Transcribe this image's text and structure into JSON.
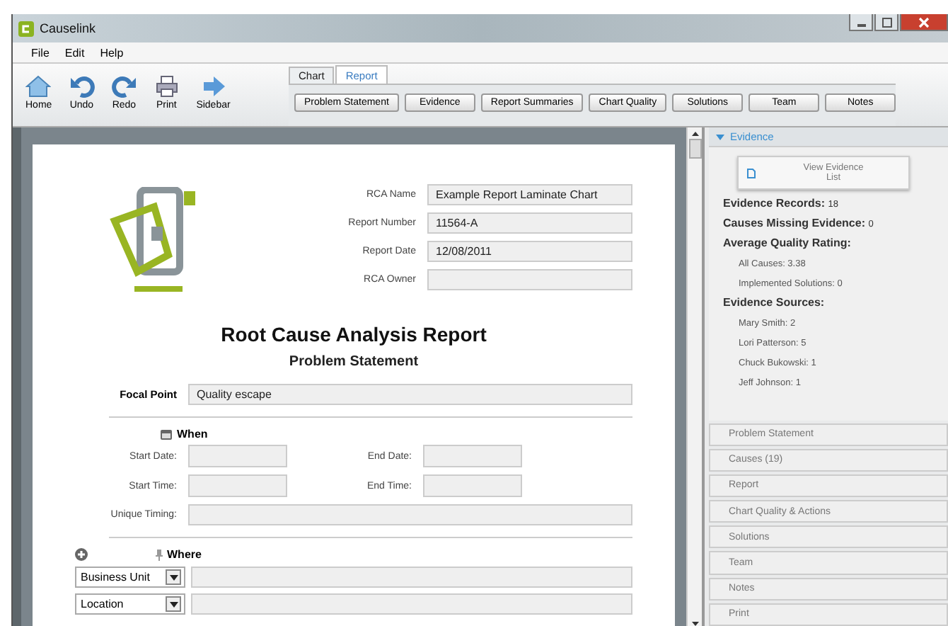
{
  "window": {
    "title": "Causelink"
  },
  "menu": [
    "File",
    "Edit",
    "Help"
  ],
  "toolbar": [
    {
      "label": "Home",
      "kind": "home"
    },
    {
      "label": "Undo",
      "kind": "undo"
    },
    {
      "label": "Redo",
      "kind": "redo"
    },
    {
      "label": "Print",
      "kind": "print"
    },
    {
      "label": "Sidebar",
      "kind": "sidebar"
    }
  ],
  "tabs": [
    {
      "label": "Chart",
      "selected": false
    },
    {
      "label": "Report",
      "selected": true
    }
  ],
  "report_buttons": [
    "Problem Statement",
    "Evidence",
    "Report Summaries",
    "Chart Quality",
    "Solutions",
    "Team",
    "Notes"
  ],
  "report": {
    "header_fields": [
      {
        "label": "RCA Name",
        "value": "Example Report Laminate Chart"
      },
      {
        "label": "Report Number",
        "value": "11564-A"
      },
      {
        "label": "Report Date",
        "value": "12/08/2011"
      },
      {
        "label": "RCA Owner"
      }
    ],
    "title": "Root Cause Analysis Report",
    "subtitle": "Problem Statement",
    "focal_point": {
      "label": "Focal Point",
      "value": "Quality escape"
    },
    "when": {
      "heading": "When",
      "start_date": "Start Date:",
      "end_date": "End Date:",
      "start_time": "Start Time:",
      "end_time": "End Time:",
      "unique_timing": "Unique Timing:"
    },
    "where": {
      "heading": "Where",
      "dropdowns": [
        "Business Unit",
        "Location"
      ]
    }
  },
  "sidebar": {
    "section": "Evidence",
    "expanded": true,
    "button": "View Evidence List",
    "stats": [
      {
        "label": "Evidence Records:",
        "value": "18"
      },
      {
        "label": "Causes Missing Evidence:",
        "value": "0"
      }
    ],
    "quality": {
      "heading": "Average Quality Rating:",
      "items": [
        "All Causes:  3.38",
        "Implemented Solutions:  0"
      ]
    },
    "sources": {
      "heading": "Evidence Sources:",
      "items": [
        "Mary Smith: 2",
        "Lori Patterson: 5",
        "Chuck Bukowski: 1",
        "Jeff Johnson: 1"
      ]
    },
    "panels": [
      "Problem Statement",
      "Causes (19)",
      "Report",
      "Chart Quality & Actions",
      "Solutions",
      "Team",
      "Notes",
      "Print"
    ]
  }
}
